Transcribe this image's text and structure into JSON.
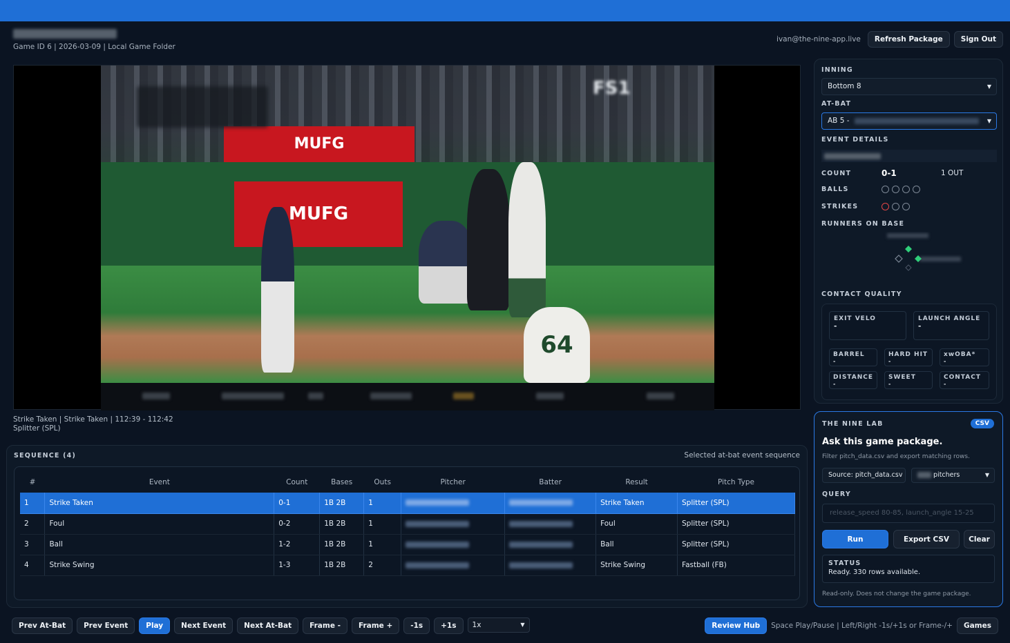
{
  "header": {
    "game_info": "Game ID 6 | 2026-03-09 | Local Game Folder",
    "email": "ivan@the-nine-app.live",
    "refresh_label": "Refresh Package",
    "signout_label": "Sign Out"
  },
  "video": {
    "caption_line1": "Strike Taken | Strike Taken | 112:39 - 112:42",
    "caption_line2": "Splitter (SPL)",
    "banner_top": "MUFG",
    "banner_main": "MUFG",
    "jersey_number": "64",
    "network": "FS1"
  },
  "sequence": {
    "title": "SEQUENCE (4)",
    "subtitle": "Selected at-bat event sequence",
    "columns": [
      "#",
      "Event",
      "Count",
      "Bases",
      "Outs",
      "Pitcher",
      "Batter",
      "Result",
      "Pitch Type"
    ],
    "rows": [
      {
        "num": "1",
        "event": "Strike Taken",
        "count": "0-1",
        "bases": "1B 2B",
        "outs": "1",
        "result": "Strike Taken",
        "pitch": "Splitter (SPL)"
      },
      {
        "num": "2",
        "event": "Foul",
        "count": "0-2",
        "bases": "1B 2B",
        "outs": "1",
        "result": "Foul",
        "pitch": "Splitter (SPL)"
      },
      {
        "num": "3",
        "event": "Ball",
        "count": "1-2",
        "bases": "1B 2B",
        "outs": "1",
        "result": "Ball",
        "pitch": "Splitter (SPL)"
      },
      {
        "num": "4",
        "event": "Strike Swing",
        "count": "1-3",
        "bases": "1B 2B",
        "outs": "2",
        "result": "Strike Swing",
        "pitch": "Fastball (FB)"
      }
    ]
  },
  "controls": {
    "prev_atbat": "Prev At-Bat",
    "prev_event": "Prev Event",
    "play": "Play",
    "next_event": "Next Event",
    "next_atbat": "Next At-Bat",
    "frame_minus": "Frame -",
    "frame_plus": "Frame +",
    "minus_1s": "-1s",
    "plus_1s": "+1s",
    "speed": "1x",
    "review_hub": "Review Hub",
    "hint": "Space Play/Pause  |  Left/Right -1s/+1s or Frame-/+",
    "games": "Games"
  },
  "details": {
    "inning_label": "INNING",
    "inning_value": "Bottom 8",
    "atbat_label": "AT-BAT",
    "atbat_value": "AB 5 -",
    "event_details_label": "EVENT DETAILS",
    "count_label": "COUNT",
    "count_value": "0-1",
    "outs_value": "1 OUT",
    "balls_label": "BALLS",
    "strikes_label": "STRIKES",
    "runners_label": "RUNNERS ON BASE",
    "contact_label": "CONTACT QUALITY",
    "exit_velo_label": "EXIT VELO",
    "exit_velo_value": "-",
    "launch_angle_label": "LAUNCH ANGLE",
    "launch_angle_value": "-",
    "barrel_label": "BARREL",
    "barrel_value": "-",
    "hardhit_label": "HARD HIT",
    "hardhit_value": "-",
    "xwoba_label": "xwOBA*",
    "xwoba_value": "-",
    "distance_label": "DISTANCE",
    "distance_value": "-",
    "sweet_label": "SWEET",
    "sweet_value": "-",
    "contact_label2": "CONTACT",
    "contact_value": "-"
  },
  "lab": {
    "label": "THE NINE LAB",
    "badge": "CSV",
    "title": "Ask this game package.",
    "desc": "Filter pitch_data.csv and export matching rows.",
    "source": "Source: pitch_data.csv",
    "dataset": "pitchers",
    "query_label": "QUERY",
    "query_placeholder": "release_speed 80-85, launch_angle 15-25",
    "run": "Run",
    "export": "Export CSV",
    "clear": "Clear",
    "status_label": "STATUS",
    "status_value": "Ready. 330 rows available.",
    "footer": "Read-only. Does not change the game package."
  },
  "colors": {
    "accent": "#1f6fd6",
    "strike": "#e24646",
    "runner": "#2fcf7a"
  }
}
